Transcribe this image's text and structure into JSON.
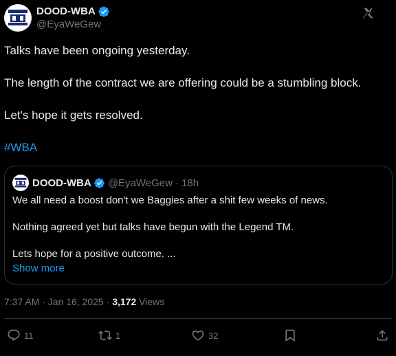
{
  "author": {
    "display_name": "DOOD-WBA",
    "handle": "@EyaWeGew",
    "avatar_text": "ALBION NO EYAWEGEW"
  },
  "post": {
    "paragraphs": [
      "Talks have been ongoing yesterday.",
      "The length of the contract we are offering could be a stumbling block.",
      "Let's hope it gets resolved."
    ],
    "hashtag": "#WBA"
  },
  "quoted_post": {
    "display_name": "DOOD-WBA",
    "handle": "@EyaWeGew",
    "time": "· 18h",
    "paragraphs": [
      "We all need a boost don't we Baggies after a shit few weeks of news.",
      "Nothing agreed yet but talks have begun with the Legend TM.",
      "Lets hope for a positive outcome. ..."
    ],
    "show_more": "Show more"
  },
  "meta": {
    "timestamp": "7:37 AM · Jan 16, 2025 · ",
    "views_count": "3,172",
    "views_label": " Views"
  },
  "actions": {
    "replies": "11",
    "reposts": "1",
    "likes": "32"
  },
  "colors": {
    "background": "#000000",
    "text": "#e7e9ea",
    "muted": "#71767b",
    "accent": "#1d9bf0",
    "border": "#2f3336"
  },
  "icons": [
    "verified-badge-icon",
    "grok-icon",
    "reply-icon",
    "repost-icon",
    "like-icon",
    "bookmark-icon",
    "share-icon"
  ]
}
